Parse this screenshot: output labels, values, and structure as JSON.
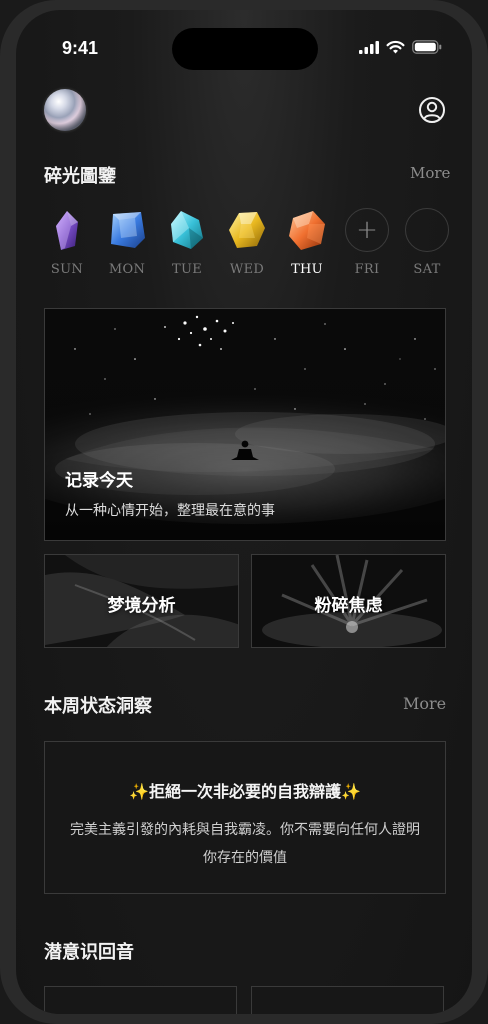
{
  "status_bar": {
    "time": "9:41"
  },
  "header": {
    "avatar_icon": "pearl-orb-avatar",
    "profile_icon": "user-circle-icon"
  },
  "gallery": {
    "title": "碎光圖鑒",
    "more": "More",
    "days": [
      {
        "label": "SUN",
        "gem_color": "#7b4fc8",
        "state": "filled"
      },
      {
        "label": "MON",
        "gem_color": "#3a7be0",
        "state": "filled"
      },
      {
        "label": "TUE",
        "gem_color": "#38c0d8",
        "state": "filled"
      },
      {
        "label": "WED",
        "gem_color": "#e8b820",
        "state": "filled"
      },
      {
        "label": "THU",
        "gem_color": "#f07030",
        "state": "filled",
        "today": true
      },
      {
        "label": "FRI",
        "state": "add",
        "symbol": "+"
      },
      {
        "label": "SAT",
        "state": "empty"
      }
    ]
  },
  "hero": {
    "title": "记录今天",
    "subtitle": "从一种心情开始，整理最在意的事"
  },
  "tiles": {
    "dream": "梦境分析",
    "anxiety": "粉碎焦虑"
  },
  "insight": {
    "title": "本周状态洞察",
    "more": "More",
    "card_title": "✨拒絕一次非必要的自我辯護✨",
    "card_body": "完美主義引發的內耗與自我霸凌。你不需要向任何人證明你存在的價值"
  },
  "echo": {
    "title": "潜意识回音"
  }
}
